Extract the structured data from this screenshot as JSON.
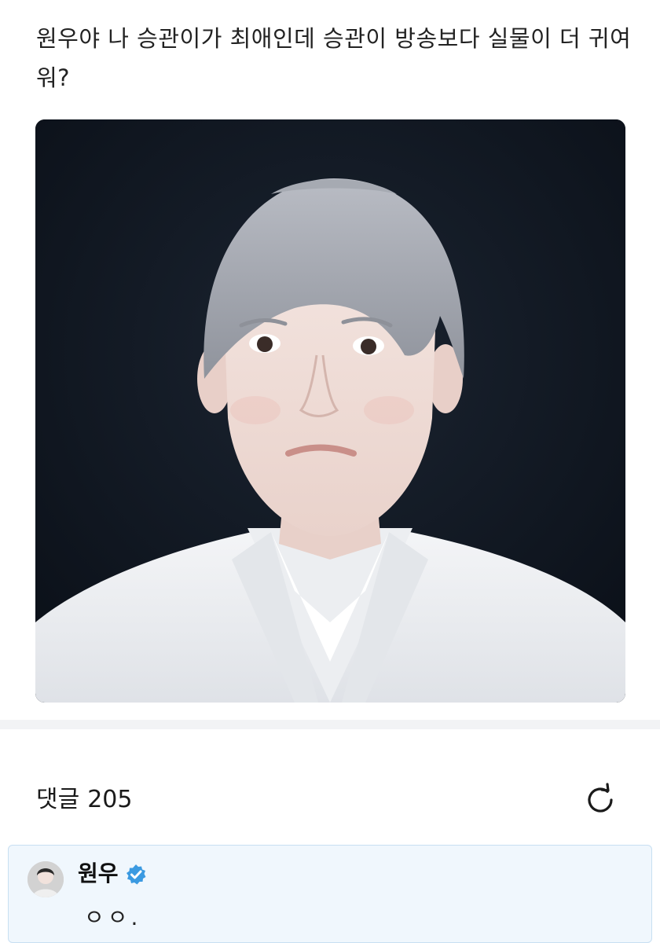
{
  "post": {
    "text": "원우야 나 승관이가 최애인데 승관이 방송보다 실물이 더 귀여워?"
  },
  "comments": {
    "label": "댓글",
    "count": "205"
  },
  "icons": {
    "refresh": "refresh-icon",
    "verified": "verified-badge-icon"
  },
  "comment": {
    "author": "원우",
    "body": "ㅇㅇ."
  },
  "colors": {
    "accent": "#3b9ae1",
    "card_background": "#f0f7fd",
    "card_border": "#c8dff2"
  }
}
